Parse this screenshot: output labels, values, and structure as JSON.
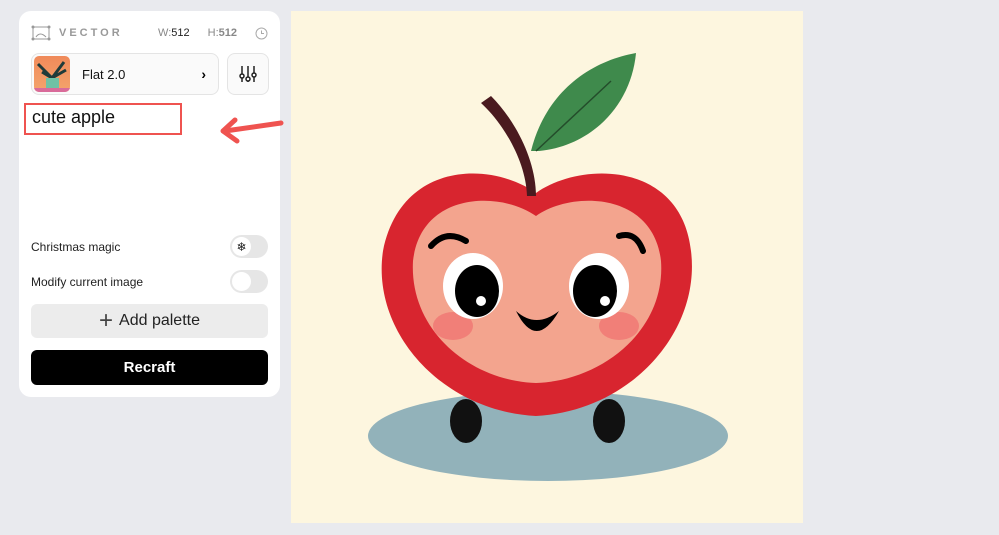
{
  "header": {
    "mode": "VECTOR",
    "width_label": "W:",
    "width": "512",
    "height_label": "H:",
    "height": "512"
  },
  "style": {
    "name": "Flat 2.0"
  },
  "prompt": {
    "value": "cute apple"
  },
  "options": [
    {
      "label": "Christmas magic",
      "on": false,
      "icon": "snowflake-icon"
    },
    {
      "label": "Modify current image",
      "on": false
    }
  ],
  "palette": {
    "label": "Add palette"
  },
  "action": {
    "label": "Recraft"
  },
  "colors": {
    "accent": "#ef5350",
    "apple": "#d8252f",
    "background": "#fdf6df"
  }
}
